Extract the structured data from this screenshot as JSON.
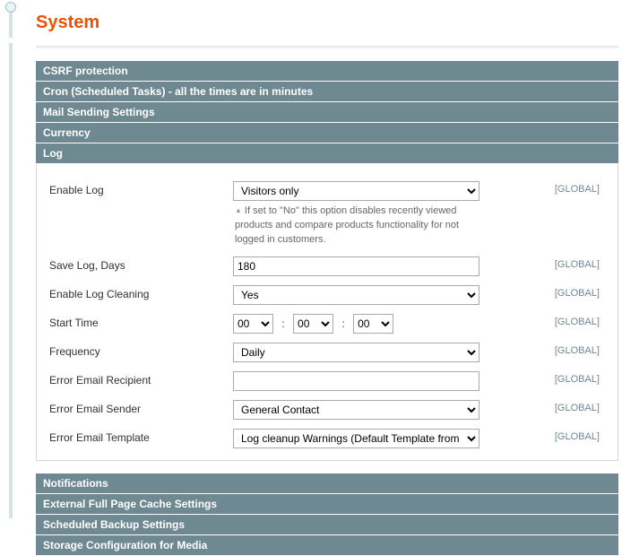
{
  "page_title": "System",
  "scope_label": "[GLOBAL]",
  "sections": {
    "csrf": "CSRF protection",
    "cron": "Cron (Scheduled Tasks) - all the times are in minutes",
    "mail": "Mail Sending Settings",
    "currency": "Currency",
    "log": "Log",
    "notifications": "Notifications",
    "fpc": "External Full Page Cache Settings",
    "backup": "Scheduled Backup Settings",
    "storage": "Storage Configuration for Media"
  },
  "log": {
    "enable_log": {
      "label": "Enable Log",
      "value": "Visitors only",
      "hint": "If set to \"No\" this option disables recently viewed products and compare products functionality for not logged in customers."
    },
    "save_log_days": {
      "label": "Save Log, Days",
      "value": "180"
    },
    "enable_cleaning": {
      "label": "Enable Log Cleaning",
      "value": "Yes"
    },
    "start_time": {
      "label": "Start Time",
      "hh": "00",
      "mm": "00",
      "ss": "00"
    },
    "frequency": {
      "label": "Frequency",
      "value": "Daily"
    },
    "err_recipient": {
      "label": "Error Email Recipient",
      "value": ""
    },
    "err_sender": {
      "label": "Error Email Sender",
      "value": "General Contact"
    },
    "err_template": {
      "label": "Error Email Template",
      "value": "Log cleanup Warnings (Default Template from Locale)"
    }
  }
}
